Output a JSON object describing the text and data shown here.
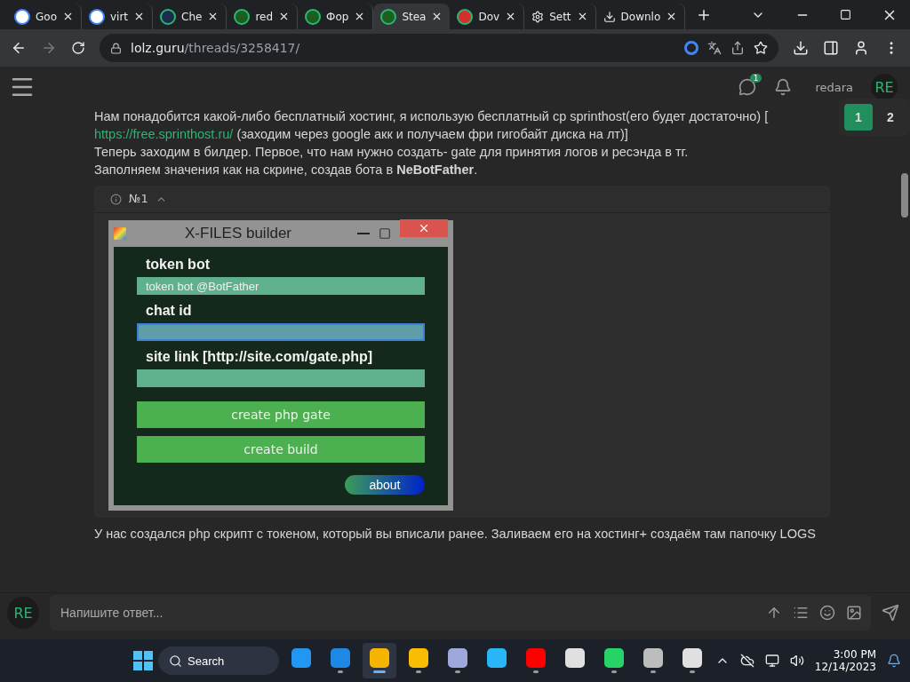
{
  "browser": {
    "tabs": [
      {
        "title": "Goo",
        "selected": false
      },
      {
        "title": "virt",
        "selected": false
      },
      {
        "title": "Che",
        "selected": false
      },
      {
        "title": "red",
        "selected": false
      },
      {
        "title": "Фор",
        "selected": false
      },
      {
        "title": "Stea",
        "selected": true
      },
      {
        "title": "Dov",
        "selected": false
      },
      {
        "title": "Sett",
        "selected": false
      },
      {
        "title": "Downlo",
        "selected": false
      }
    ],
    "address": {
      "host": "lolz.guru",
      "path": "/threads/3258417/"
    }
  },
  "header": {
    "notification_count": "1",
    "username": "redara",
    "avatar": "RE"
  },
  "pagination": [
    {
      "label": "1",
      "selected": true
    },
    {
      "label": "2",
      "selected": false
    }
  ],
  "post": {
    "paragraphs": [
      {
        "kind": "text",
        "text": "Нам понадобится какой-либо бесплатный хостинг, я использую бесплатный cp sprinthost(его будет достаточно) ["
      },
      {
        "kind": "link",
        "url": "https://free.sprinthost.ru/",
        "text": " (заходим через google акк и получаем фри гигобайт диска на лт)]"
      },
      {
        "kind": "text",
        "text": "Теперь заходим в билдер. Первое, что нам нужно создать- gate для принятия логов и ресэнда в тг."
      },
      {
        "kind": "text",
        "text": "Заполняем значения как на скрине, создав бота в **NeBotFather**."
      }
    ],
    "spoiler": {
      "title": "№1",
      "expanded": true,
      "window": {
        "title": "X-FILES builder",
        "fields": [
          {
            "label": "token bot",
            "value": "token bot @BotFather",
            "focused": false
          },
          {
            "label": "chat id",
            "focused": true
          },
          {
            "label": "site link [http://site.com/gate.php]",
            "focused": false
          }
        ],
        "buttons": [
          "create php gate",
          "create build"
        ],
        "about": "about"
      }
    },
    "after": "У нас создался php скрипт с токеном, который вы вписали ранее. Заливаем его на хостинг+ создаём там папочку LOGS"
  },
  "reply": {
    "avatar": "RE",
    "placeholder": "Напишите ответ..."
  },
  "taskbar": {
    "search": "Search",
    "apps": [
      {
        "running": false,
        "selected": false
      },
      {
        "running": true,
        "selected": false
      },
      {
        "running": true,
        "selected": true
      },
      {
        "running": true,
        "selected": false
      },
      {
        "running": true,
        "selected": false
      },
      {
        "running": false,
        "selected": false
      },
      {
        "running": true,
        "selected": false
      },
      {
        "running": false,
        "selected": false
      },
      {
        "running": true,
        "selected": false
      },
      {
        "running": true,
        "selected": false
      },
      {
        "running": true,
        "selected": false
      }
    ],
    "time": "3:00 PM",
    "date": "12/14/2023"
  }
}
